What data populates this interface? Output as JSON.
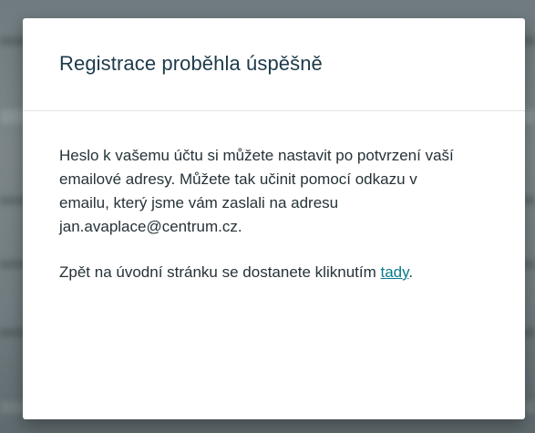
{
  "dialog": {
    "title": "Registrace proběhla úspěšně",
    "paragraph1_text": "Heslo k vašemu účtu si můžete nastavit po potvrzení vaší emailové adresy. Můžete tak učinit pomocí odkazu v emailu, který jsme vám zaslali na adresu",
    "email": "jan.avaplace@centrum.cz.",
    "paragraph2_before_link": "Zpět na úvodní stránku se dostanete kliknutím ",
    "link_label": "tady",
    "paragraph2_after_link": "."
  },
  "colors": {
    "title": "#1d3a4a",
    "body_text": "#263238",
    "link": "#0a7a8c",
    "overlay": "#717c80",
    "dialog_background": "#ffffff"
  }
}
